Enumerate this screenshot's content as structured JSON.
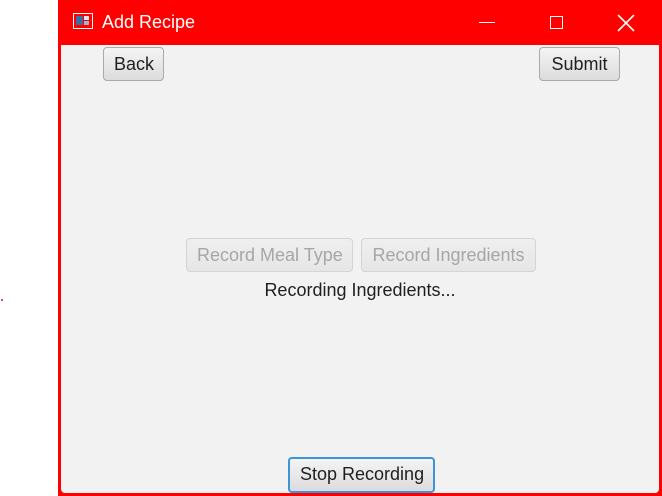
{
  "window": {
    "title": "Add Recipe",
    "titlebar_color": "#ff0000",
    "icons": {
      "app": "app-window-icon",
      "minimize": "minimize-icon",
      "maximize": "maximize-icon",
      "close": "close-icon"
    }
  },
  "toolbar": {
    "back_label": "Back",
    "submit_label": "Submit"
  },
  "recording": {
    "meal_type_label": "Record Meal Type",
    "ingredients_label": "Record Ingredients",
    "status": "Recording Ingredients...",
    "stop_label": "Stop Recording",
    "meal_type_enabled": false,
    "ingredients_enabled": false
  },
  "colors": {
    "accent_focus": "#3c95d6",
    "client_background": "#f2f2f2"
  }
}
